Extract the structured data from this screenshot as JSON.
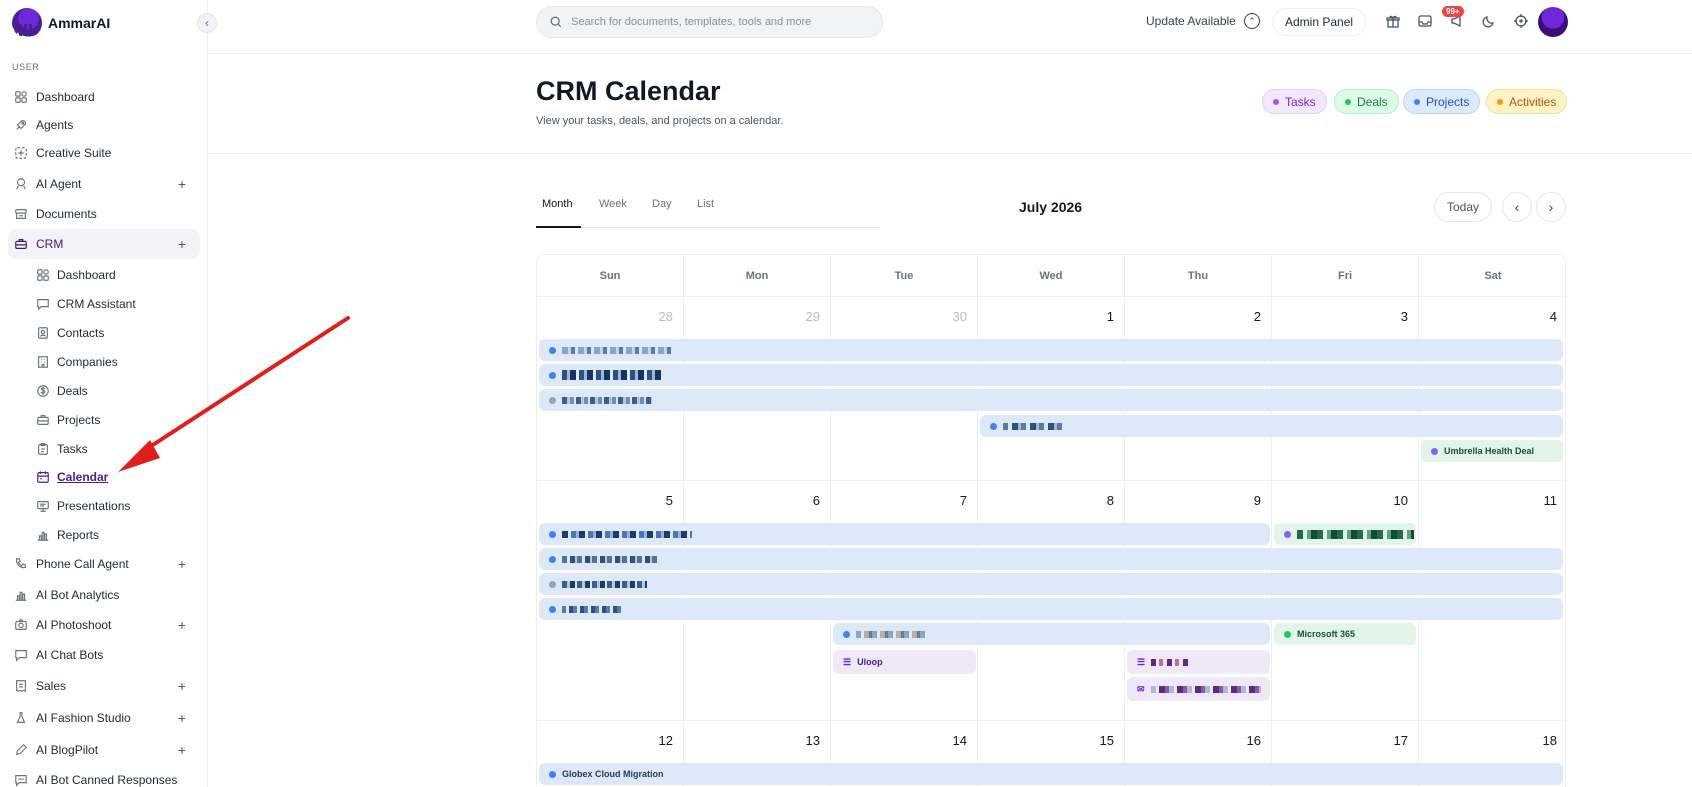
{
  "brand": {
    "name": "AmmarAI"
  },
  "sidebar": {
    "section_label": "USER",
    "items": [
      {
        "label": "Dashboard",
        "icon": "grid-icon"
      },
      {
        "label": "Agents",
        "icon": "rocket-icon"
      },
      {
        "label": "Creative Suite",
        "icon": "sparkle-icon"
      },
      {
        "label": "AI Agent",
        "icon": "robot-icon",
        "plus": "+"
      },
      {
        "label": "Documents",
        "icon": "archive-icon"
      },
      {
        "label": "CRM",
        "icon": "briefcase-icon",
        "plus": "+"
      },
      {
        "label": "Phone Call Agent",
        "icon": "phone-icon",
        "plus": "+"
      },
      {
        "label": "AI Bot Analytics",
        "icon": "chart-icon"
      },
      {
        "label": "AI Photoshoot",
        "icon": "camera-icon",
        "plus": "+"
      },
      {
        "label": "AI Chat Bots",
        "icon": "chat-icon"
      },
      {
        "label": "Sales",
        "icon": "receipt-icon",
        "plus": "+"
      },
      {
        "label": "AI Fashion Studio",
        "icon": "hanger-icon",
        "plus": "+"
      },
      {
        "label": "AI BlogPilot",
        "icon": "pen-icon",
        "plus": "+"
      },
      {
        "label": "AI Bot Canned Responses",
        "icon": "reply-icon"
      }
    ],
    "crm_sub": [
      {
        "label": "Dashboard",
        "icon": "grid-icon"
      },
      {
        "label": "CRM Assistant",
        "icon": "chat-icon"
      },
      {
        "label": "Contacts",
        "icon": "contact-icon"
      },
      {
        "label": "Companies",
        "icon": "building-icon"
      },
      {
        "label": "Deals",
        "icon": "dollar-icon"
      },
      {
        "label": "Projects",
        "icon": "briefcase-icon"
      },
      {
        "label": "Tasks",
        "icon": "clipboard-icon"
      },
      {
        "label": "Calendar",
        "icon": "calendar-icon"
      },
      {
        "label": "Presentations",
        "icon": "presentation-icon"
      },
      {
        "label": "Reports",
        "icon": "chart-icon"
      }
    ]
  },
  "topbar": {
    "search_placeholder": "Search for documents, templates, tools and more",
    "update_label": "Update Available",
    "admin_label": "Admin Panel",
    "notification_badge": "99+"
  },
  "header": {
    "title": "CRM Calendar",
    "subtitle": "View your tasks, deals, and projects on a calendar.",
    "legend": [
      {
        "label": "Tasks",
        "color": "#a855f7",
        "bg": "#f3e8ff",
        "border": "#e3cdfb",
        "text": "#7e22ce"
      },
      {
        "label": "Deals",
        "color": "#22c55e",
        "bg": "#dcfce7",
        "border": "#bde9cc",
        "text": "#15803d"
      },
      {
        "label": "Projects",
        "color": "#3b82f6",
        "bg": "#dbeafe",
        "border": "#bcd4f7",
        "text": "#1d4ed8"
      },
      {
        "label": "Activities",
        "color": "#f59e0b",
        "bg": "#fef3c7",
        "border": "#f6dd9a",
        "text": "#b45309"
      }
    ]
  },
  "calendar": {
    "tabs": [
      "Month",
      "Week",
      "Day",
      "List"
    ],
    "active_tab": "Month",
    "month_title": "July 2026",
    "today_label": "Today",
    "prev_icon": "‹",
    "next_icon": "›",
    "days_of_week": [
      "Sun",
      "Mon",
      "Tue",
      "Wed",
      "Thu",
      "Fri",
      "Sat"
    ],
    "weeks": [
      [
        "28",
        "29",
        "30",
        "1",
        "2",
        "3",
        "4"
      ],
      [
        "5",
        "6",
        "7",
        "8",
        "9",
        "10",
        "11"
      ],
      [
        "12",
        "13",
        "14",
        "15",
        "16",
        "17",
        "18"
      ]
    ],
    "events": {
      "umbrella": "Umbrella Health Deal",
      "uloop": "Uloop",
      "microsoft": "Microsoft 365",
      "globex": "Globex Cloud Migration"
    }
  }
}
